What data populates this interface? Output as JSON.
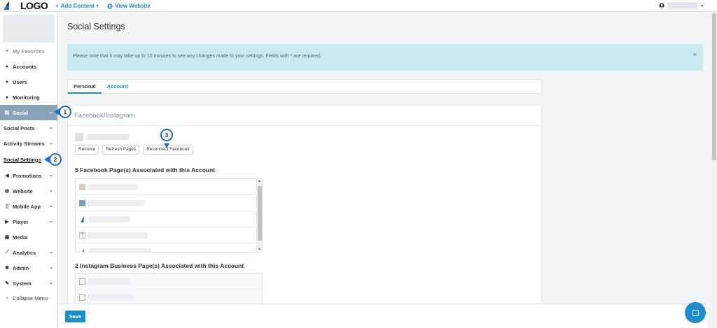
{
  "topbar": {
    "logo": "LOGO",
    "add_content": "Add Content",
    "view_website": "View Website"
  },
  "sidebar": {
    "items": [
      {
        "label": "My Favorites",
        "icon": "heart-icon"
      },
      {
        "label": "Accounts",
        "icon": "circle-dot-icon"
      },
      {
        "label": "Users",
        "icon": "circle-dot-icon"
      },
      {
        "label": "Monitoring",
        "icon": "circle-dot-icon"
      },
      {
        "label": "Social",
        "icon": "chat-icon"
      },
      {
        "label": "Social Posts"
      },
      {
        "label": "Activity Streams"
      },
      {
        "label": "Social Settings"
      },
      {
        "label": "Promotions",
        "icon": "megaphone-icon"
      },
      {
        "label": "Website",
        "icon": "globe-icon"
      },
      {
        "label": "Mobile App",
        "icon": "phone-icon"
      },
      {
        "label": "Player",
        "icon": "play-icon"
      },
      {
        "label": "Media",
        "icon": "image-icon"
      },
      {
        "label": "Analytics",
        "icon": "chart-icon"
      },
      {
        "label": "Admin",
        "icon": "gear-icon"
      },
      {
        "label": "System",
        "icon": "wrench-icon"
      },
      {
        "label": "Collapse Menu",
        "icon": "chevron-left-icon"
      }
    ]
  },
  "callouts": [
    "1",
    "2",
    "3"
  ],
  "main": {
    "title": "Social Settings",
    "notice": "Please note that it may take up to 10 minutes to see any changes made to your settings. Fields with * are required.",
    "tabs": [
      "Personal",
      "Account"
    ],
    "panel_title": "Facebook/Instagram",
    "buttons": {
      "remove": "Remove",
      "refresh": "Refresh Pages",
      "reconnect": "Reconnect Facebook"
    },
    "fb_label": "5 Facebook Page(s) Associated with this Account",
    "ig_label": "2 Instagram Business Page(s) Associated with this Account",
    "save": "Save"
  },
  "colors": {
    "accent": "#1a8fc9",
    "callout": "#1f6fcf",
    "active_nav": "#8aa3b8",
    "notice_bg": "#c8eaf0"
  }
}
